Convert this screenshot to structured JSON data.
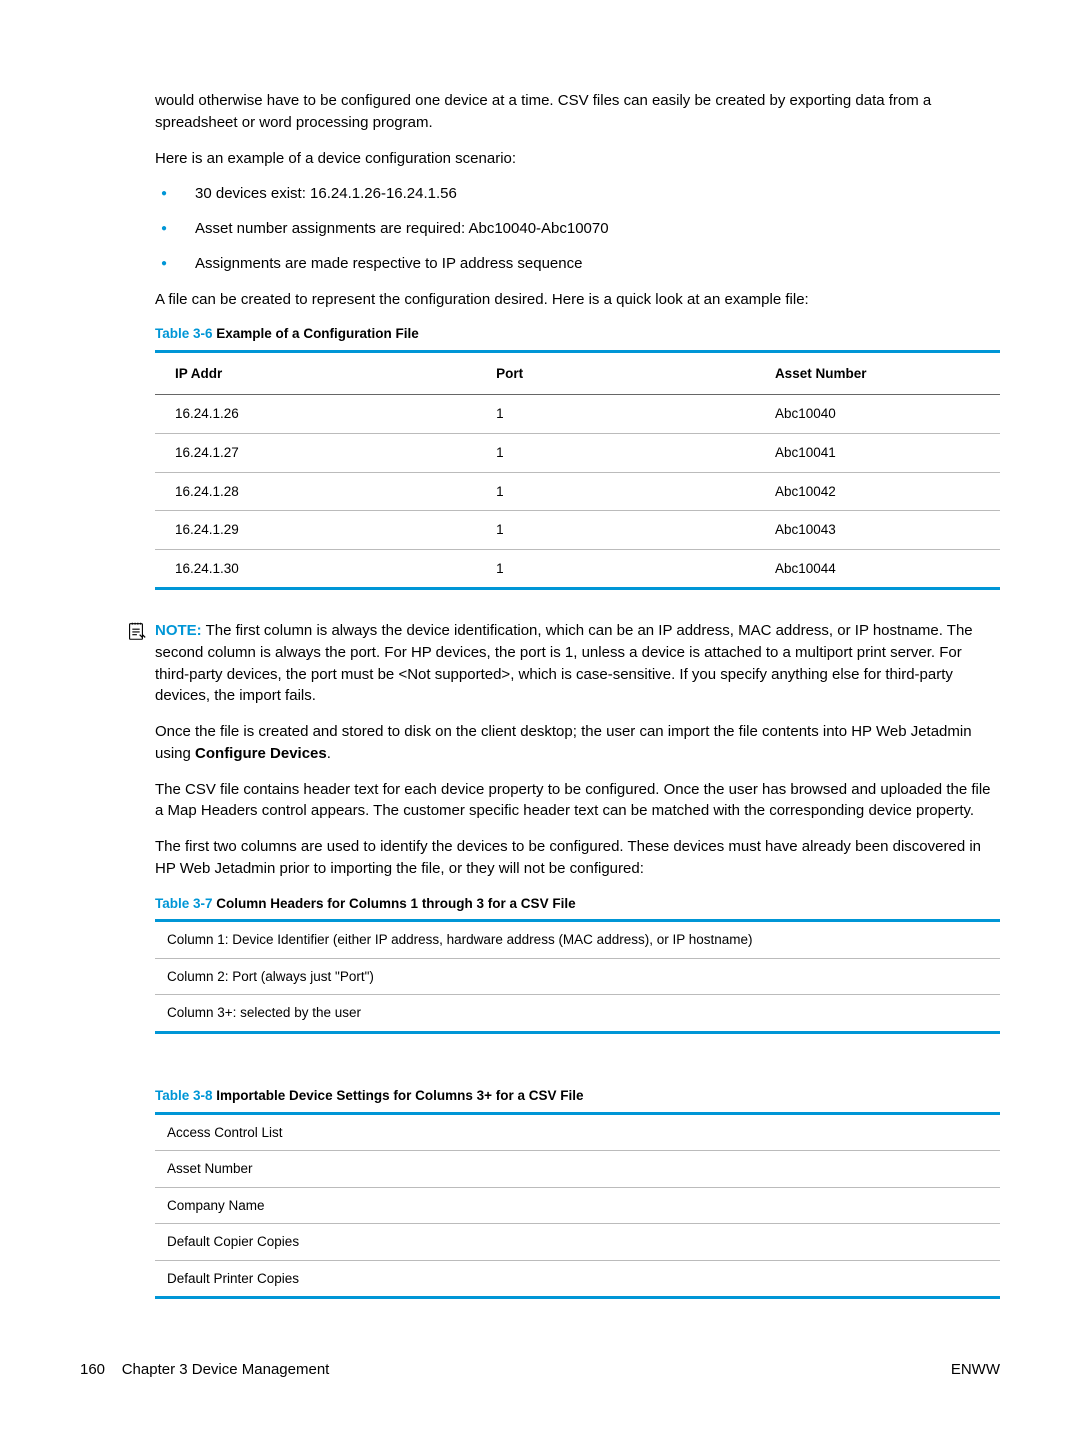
{
  "intro": {
    "p1": "would otherwise have to be configured one device at a time. CSV files can easily be created by exporting data from a spreadsheet or word processing program.",
    "p2": "Here is an example of a device configuration scenario:",
    "bullets": [
      "30 devices exist: 16.24.1.26-16.24.1.56",
      "Asset number assignments are required: Abc10040-Abc10070",
      "Assignments are made respective to IP address sequence"
    ],
    "p3": "A file can be created to represent the configuration desired. Here is a quick look at an example file:"
  },
  "table36": {
    "caption_prefix": "Table 3-6",
    "caption_title": "  Example of a Configuration File",
    "headers": {
      "ip": "IP Addr",
      "port": "Port",
      "asset": "Asset Number"
    },
    "rows": [
      {
        "ip": "16.24.1.26",
        "port": "1",
        "asset": "Abc10040"
      },
      {
        "ip": "16.24.1.27",
        "port": "1",
        "asset": "Abc10041"
      },
      {
        "ip": "16.24.1.28",
        "port": "1",
        "asset": "Abc10042"
      },
      {
        "ip": "16.24.1.29",
        "port": "1",
        "asset": "Abc10043"
      },
      {
        "ip": "16.24.1.30",
        "port": "1",
        "asset": "Abc10044"
      }
    ]
  },
  "note": {
    "label": "NOTE:",
    "text": "The first column is always the device identification, which can be an IP address, MAC address, or IP hostname. The second column is always the port. For HP devices, the port is 1, unless a device is attached to a multiport print server. For third-party devices, the port must be <Not supported>, which is case-sensitive. If you specify anything else for third-party devices, the import fails."
  },
  "post_note": {
    "p1a": "Once the file is created and stored to disk on the client desktop; the user can import the file contents into HP Web Jetadmin using ",
    "p1_bold": "Configure Devices",
    "p1b": ".",
    "p2": "The CSV file contains header text for each device property to be configured. Once the user has browsed and uploaded the file a Map Headers control appears. The customer specific header text can be matched with the corresponding device property.",
    "p3": "The first two columns are used to identify the devices to be configured. These devices must have already been discovered in HP Web Jetadmin prior to importing the file, or they will not be configured:"
  },
  "table37": {
    "caption_prefix": "Table 3-7",
    "caption_title": "  Column Headers for Columns 1 through 3 for a CSV File",
    "rows": [
      "Column 1: Device Identifier (either IP address, hardware address (MAC address), or IP hostname)",
      "Column 2: Port (always just \"Port\")",
      "Column 3+: selected by the user"
    ]
  },
  "table38": {
    "caption_prefix": "Table 3-8",
    "caption_title": "  Importable Device Settings for Columns 3+ for a CSV File",
    "rows": [
      "Access Control List",
      "Asset Number",
      "Company Name",
      "Default Copier Copies",
      "Default Printer Copies"
    ]
  },
  "footer": {
    "page": "160",
    "chapter": "Chapter 3   Device Management",
    "right": "ENWW"
  }
}
